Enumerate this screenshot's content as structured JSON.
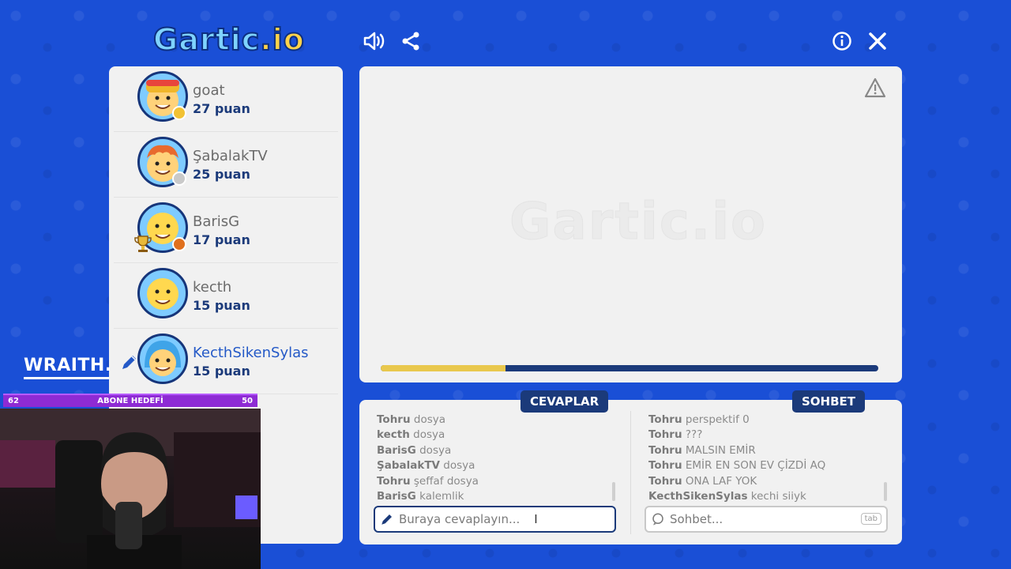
{
  "header": {
    "logo_main": "Gartic",
    "logo_suffix": ".io",
    "icons": [
      "volume-icon",
      "share-icon",
      "info-icon",
      "close-icon"
    ]
  },
  "players": [
    {
      "name": "goat",
      "score": "27 puan",
      "status_color": "#f2c233"
    },
    {
      "name": "ŞabalakTV",
      "score": "25 puan",
      "status_color": "#c9c9c9"
    },
    {
      "name": "BarisG",
      "score": "17 puan",
      "status_color": "#e0701e"
    },
    {
      "name": "kecth",
      "score": "15 puan",
      "status_color": ""
    },
    {
      "name": "KecthSikenSylas",
      "score": "15 puan",
      "status_color": ""
    }
  ],
  "canvas": {
    "watermark": "Gartic.io",
    "timer_progress": 0.25
  },
  "answers": {
    "title": "CEVAPLAR",
    "messages": [
      {
        "user": "Tohru",
        "text": "dosya"
      },
      {
        "user": "kecth",
        "text": "dosya"
      },
      {
        "user": "BarisG",
        "text": "dosya"
      },
      {
        "user": "ŞabalakTV",
        "text": "dosya"
      },
      {
        "user": "Tohru",
        "text": "şeffaf dosya"
      },
      {
        "user": "BarisG",
        "text": "kalemlik"
      }
    ],
    "placeholder": "Buraya cevaplayın..."
  },
  "chat": {
    "title": "SOHBET",
    "messages": [
      {
        "user": "Tohru",
        "text": "perspektif 0"
      },
      {
        "user": "Tohru",
        "text": "???"
      },
      {
        "user": "Tohru",
        "text": "MALSIN EMİR"
      },
      {
        "user": "Tohru",
        "text": "EMİR EN SON EV ÇİZDİ AQ"
      },
      {
        "user": "Tohru",
        "text": "ONA LAF YOK"
      },
      {
        "user": "KecthSikenSylas",
        "text": "kechi siiyk"
      }
    ],
    "placeholder": "Sohbet...",
    "tab_hint": "tab"
  },
  "stream_overlay": {
    "brand": "WRAITH.",
    "sub_goal_current": "62",
    "sub_goal_label": "ABONE HEDEFİ",
    "sub_goal_target": "50"
  }
}
